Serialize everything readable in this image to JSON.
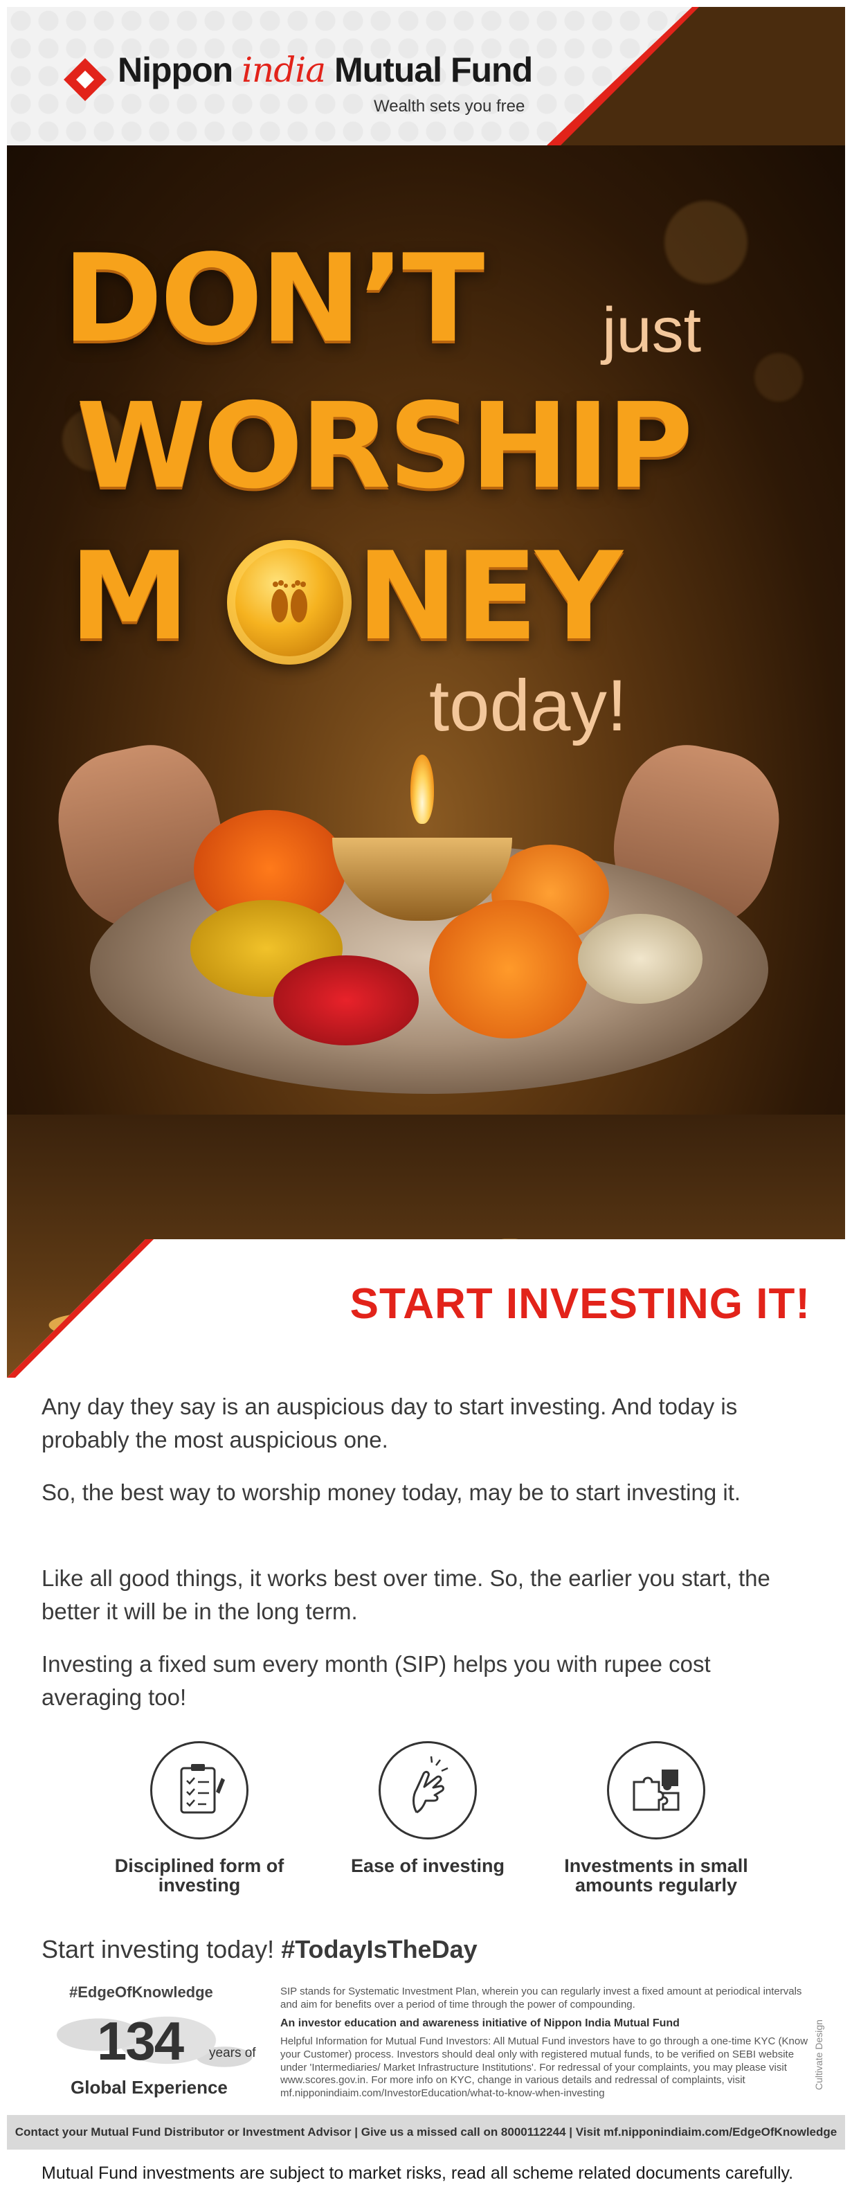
{
  "header": {
    "brand_part1": "Nippon ",
    "brand_india": "india",
    "brand_part2": " Mutual Fund",
    "tagline": "Wealth sets you free"
  },
  "hero": {
    "line1": "DON’T",
    "line1_small": "just",
    "line2": "WORSHIP",
    "line3_a": "M",
    "line3_b": "NEY",
    "line4": "today!"
  },
  "cta": "START INVESTING IT!",
  "paragraphs": [
    "Any day they say is an auspicious day to start investing. And today is probably the most auspicious one.",
    "So, the best way to worship money today, may be to start investing it.",
    "Like all good things, it works best over time. So, the earlier you start, the better it will be in the long term.",
    "Investing a fixed sum every month (SIP) helps you with rupee cost averaging too!"
  ],
  "features": [
    {
      "label": "Disciplined form of investing",
      "icon": "checklist-icon"
    },
    {
      "label": "Ease of investing",
      "icon": "snap-fingers-icon"
    },
    {
      "label": "Investments in small amounts regularly",
      "icon": "puzzle-icon"
    }
  ],
  "start_line": {
    "text": "Start investing today! ",
    "hashtag": "#TodayIsTheDay"
  },
  "edge": {
    "tag": "#EdgeOfKnowledge",
    "number": "134",
    "years": "years of",
    "global": "Global Experience"
  },
  "fine_print": {
    "sip_note": "SIP stands for Systematic Investment Plan, wherein you can regularly invest a fixed amount at periodical intervals and aim for benefits over a period of time through the power of compounding.",
    "initiative": "An investor education and awareness initiative of Nippon India Mutual Fund",
    "helpful": "Helpful Information for Mutual Fund Investors: All Mutual Fund investors have to go through a one-time KYC (Know your Customer) process. Investors should deal only with registered mutual funds, to be verified on SEBI website under 'Intermediaries/ Market Infrastructure Institutions'. For redressal of your complaints, you may please visit www.scores.gov.in. For more info on KYC, change in various details and redressal of complaints, visit mf.nipponindiaim.com/InvestorEducation/what-to-know-when-investing"
  },
  "side_credit": "Cultivate Design",
  "contact_bar": "Contact your Mutual Fund Distributor or Investment Advisor | Give us a missed call on 8000112244 | Visit mf.nipponindiaim.com/EdgeOfKnowledge",
  "disclaimer": "Mutual Fund investments are subject to market risks, read all scheme related documents carefully.",
  "colors": {
    "brand_red": "#e2231a",
    "headline_gold": "#f7a21b",
    "text_dark": "#3a3a3a"
  }
}
